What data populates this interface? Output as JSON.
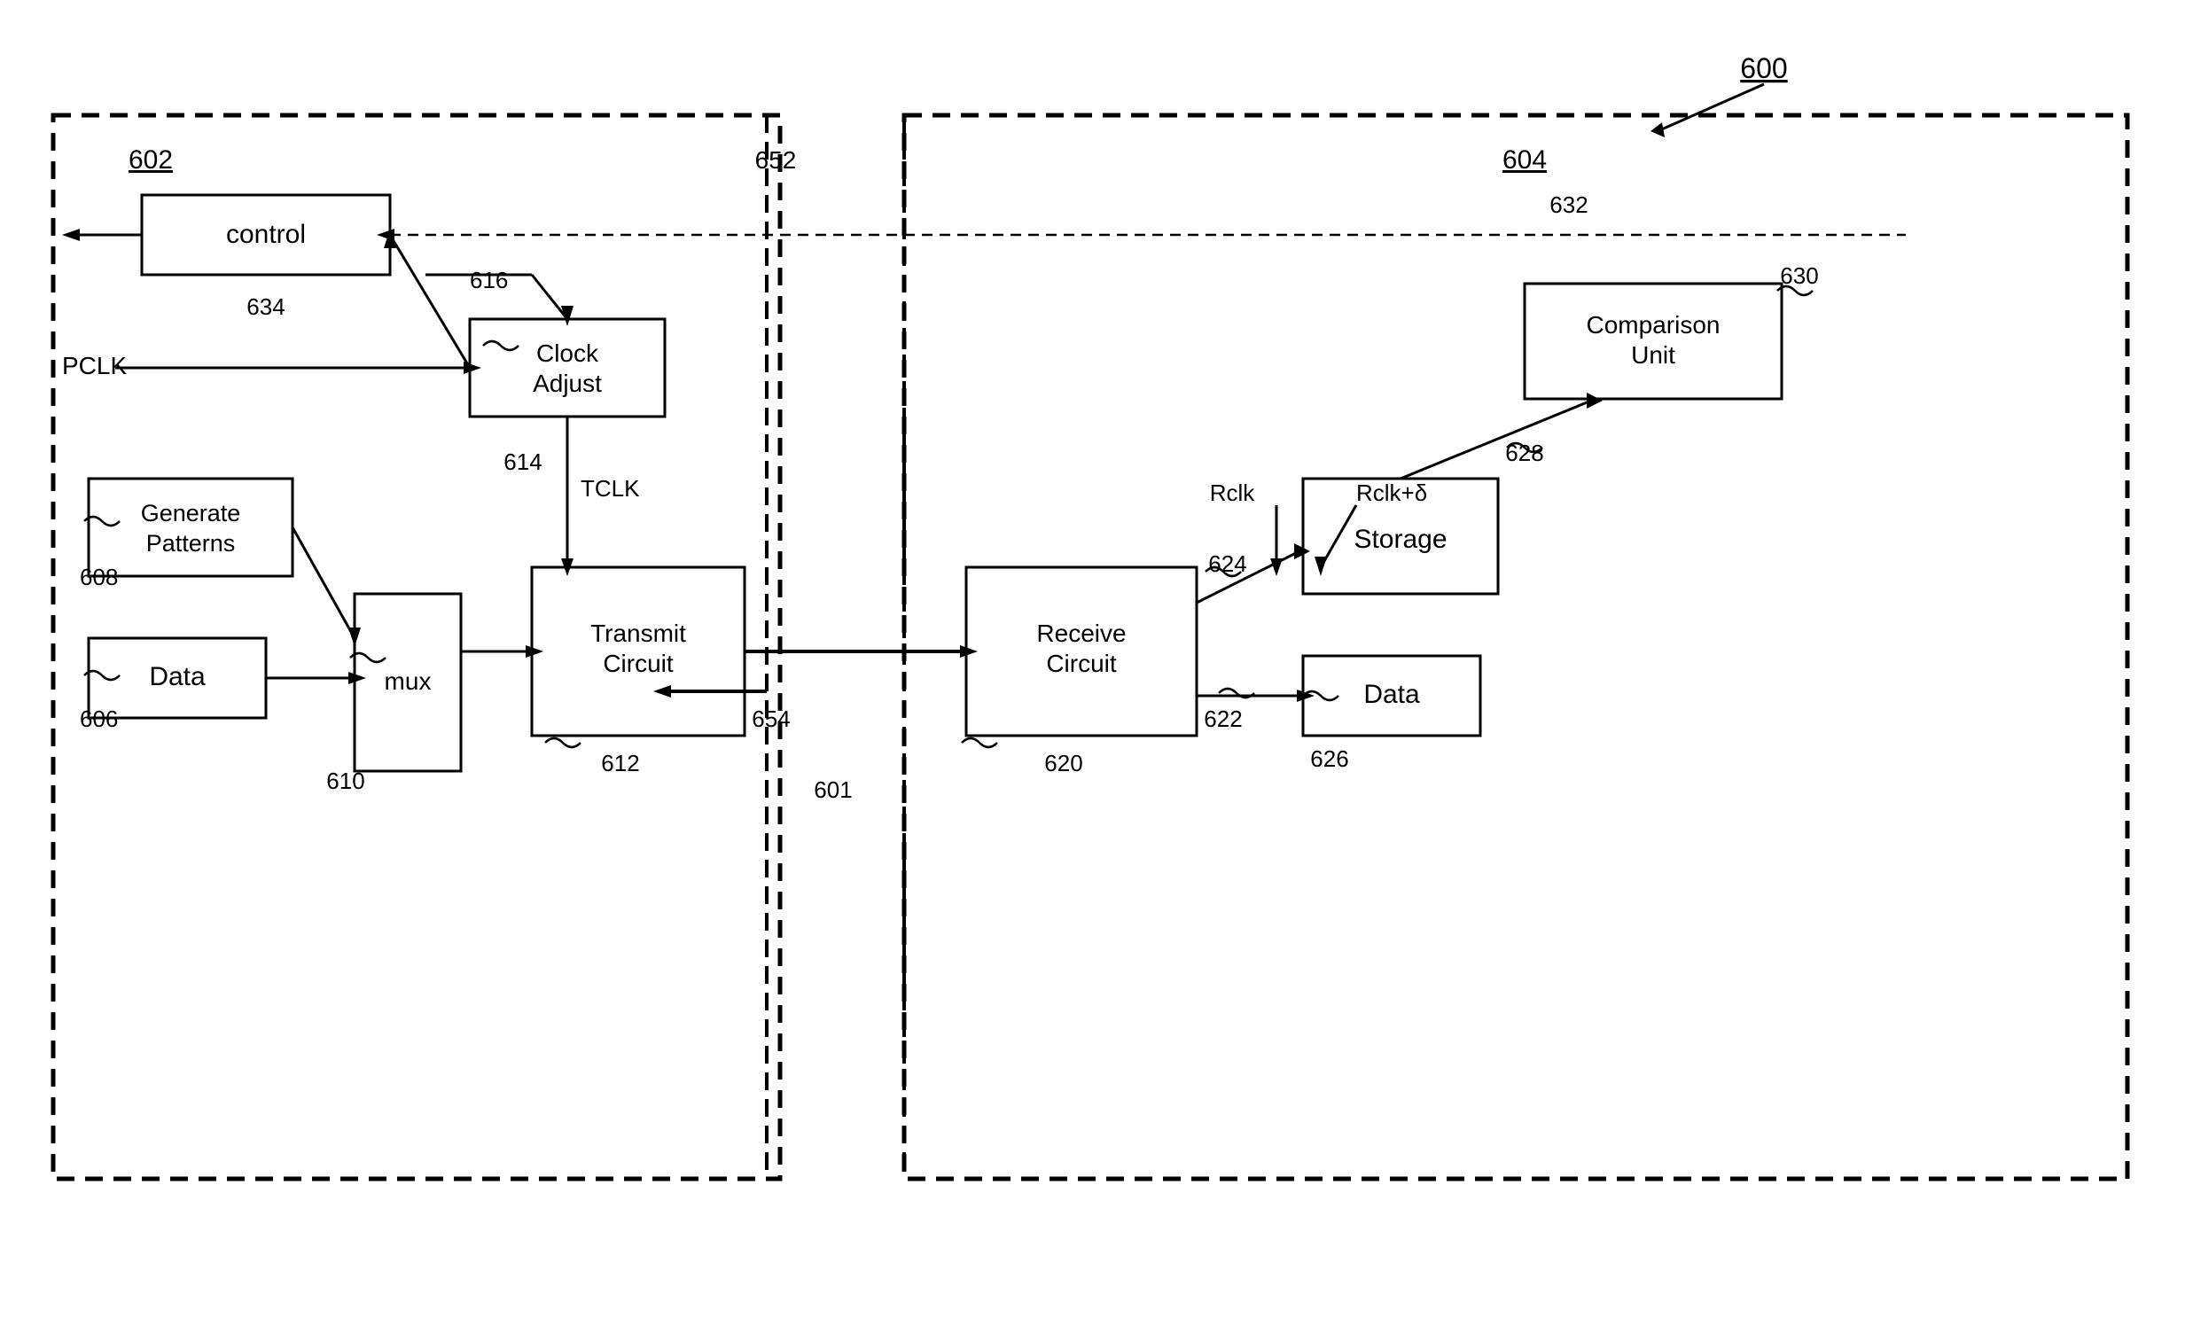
{
  "diagram": {
    "title": "600",
    "main_ref_label": "600",
    "left_block_label": "602",
    "right_block_label": "604",
    "divider_label": "652",
    "boxes": {
      "control": "control",
      "clock_adjust": "Clock\nAdjust",
      "generate_patterns": "Generate\nPatterns",
      "data_left": "Data",
      "mux": "mux",
      "transmit_circuit": "Transmit\nCircuit",
      "receive_circuit": "Receive\nCircuit",
      "storage": "Storage",
      "data_right": "Data",
      "comparison_unit": "Comparison\nUnit"
    },
    "labels": {
      "pclk": "PCLK",
      "tclk": "TCLK",
      "rclk": "Rclk",
      "rclk_delta": "Rclk+δ",
      "n600": "600",
      "n601": "601",
      "n602": "602",
      "n604": "604",
      "n606": "606",
      "n608": "608",
      "n610": "610",
      "n612": "612",
      "n614": "614",
      "n616": "616",
      "n620": "620",
      "n622": "622",
      "n624": "624",
      "n626": "626",
      "n628": "628",
      "n630": "630",
      "n632": "632",
      "n634": "634",
      "n652": "652",
      "n654": "654"
    }
  }
}
